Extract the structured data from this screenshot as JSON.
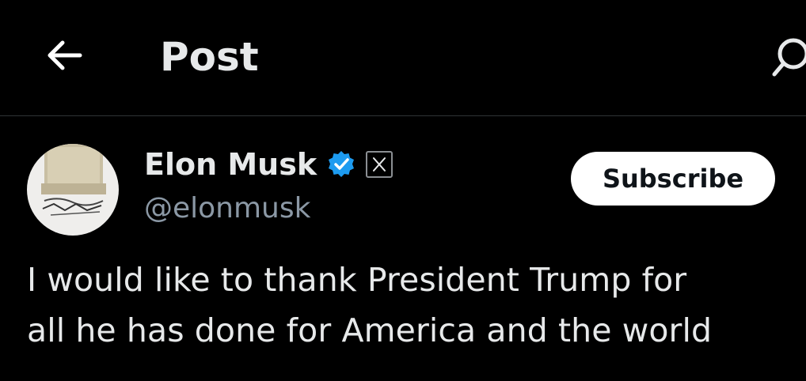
{
  "header": {
    "title": "Post",
    "back_icon": "arrow-left-icon",
    "search_icon": "search-icon"
  },
  "author": {
    "display_name": "Elon Musk",
    "handle": "@elonmusk",
    "verified_icon": "verified-badge-icon",
    "affiliation_icon": "x-logo-icon",
    "avatar": "profile-avatar"
  },
  "actions": {
    "subscribe_label": "Subscribe"
  },
  "post": {
    "text": "I would like to thank President Trump for\nall he has done for America and the world"
  },
  "colors": {
    "background": "#000000",
    "text_primary": "#e7e9ea",
    "text_secondary": "#8b98a5",
    "verified": "#1d9bf0",
    "divider": "#2f3336",
    "button_bg": "#ffffff",
    "button_text": "#0f1419"
  }
}
